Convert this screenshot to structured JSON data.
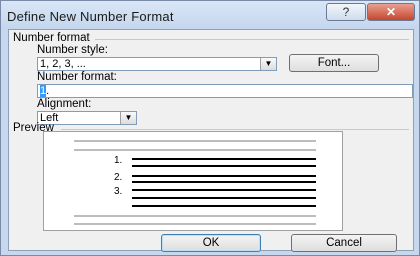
{
  "window": {
    "title": "Define New Number Format"
  },
  "titlebar": {
    "help_glyph": "?",
    "close_glyph": "✕"
  },
  "number_format_group": {
    "heading": "Number format",
    "number_style_label": "Number style:",
    "number_style_value": "1, 2, 3, ...",
    "font_button": "Font...",
    "number_format_label": "Number format:",
    "number_format_selected": "1",
    "number_format_rest": ".",
    "alignment_label": "Alignment:",
    "alignment_value": "Left"
  },
  "preview": {
    "heading": "Preview",
    "items": [
      "1.",
      "2.",
      "3."
    ]
  },
  "footer": {
    "ok_button": "OK",
    "cancel_button": "Cancel"
  }
}
